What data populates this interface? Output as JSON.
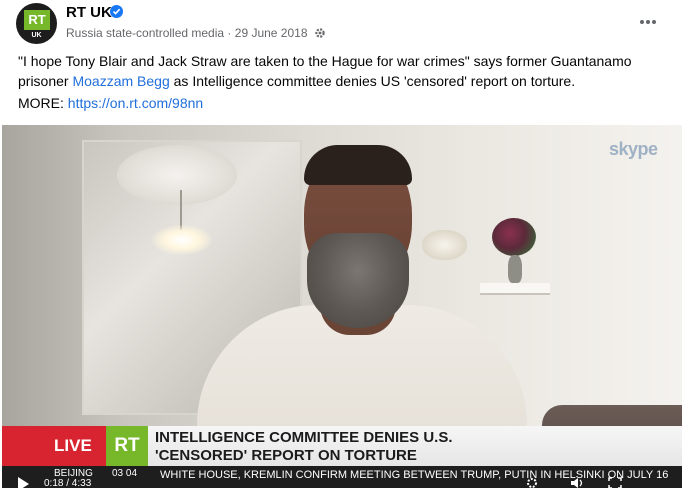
{
  "post": {
    "page_name": "RT UK",
    "avatar_text": "RT",
    "avatar_sub": "UK",
    "label": "Russia state-controlled media",
    "separator": "·",
    "date": "29 June 2018",
    "text_before_link": "\"I hope Tony Blair and Jack Straw are taken to the Hague for war crimes\" says former Guantanamo prisoner ",
    "link_name": "Moazzam Begg",
    "text_after_link": " as Intelligence committee denies US 'censored' report on torture.",
    "more_label": "MORE: ",
    "more_url": "https://on.rt.com/98nn"
  },
  "video": {
    "watermark": "skype",
    "live_label": "LIVE",
    "channel_logo": "RT",
    "headline_line1": "INTELLIGENCE COMMITTEE DENIES U.S.",
    "headline_line2": "'CENSORED' REPORT ON TORTURE",
    "ticker_city": "BEIJING",
    "ticker_time": "03 04",
    "ticker_text": "WHITE HOUSE, KREMLIN CONFIRM MEETING BETWEEN TRUMP, PUTIN IN HELSINKI ON JULY 16",
    "timecode": "0:18 / 4:33"
  },
  "icons": {
    "verified": "verified-badge-icon",
    "audience": "gear-icon",
    "more": "more-horizontal-icon",
    "play": "play-icon",
    "settings": "settings-icon",
    "volume": "volume-icon",
    "fullscreen": "fullscreen-icon"
  },
  "colors": {
    "link": "#216fdb",
    "verified": "#1877f2",
    "live_red": "#d82430",
    "rt_green": "#77b82a"
  }
}
